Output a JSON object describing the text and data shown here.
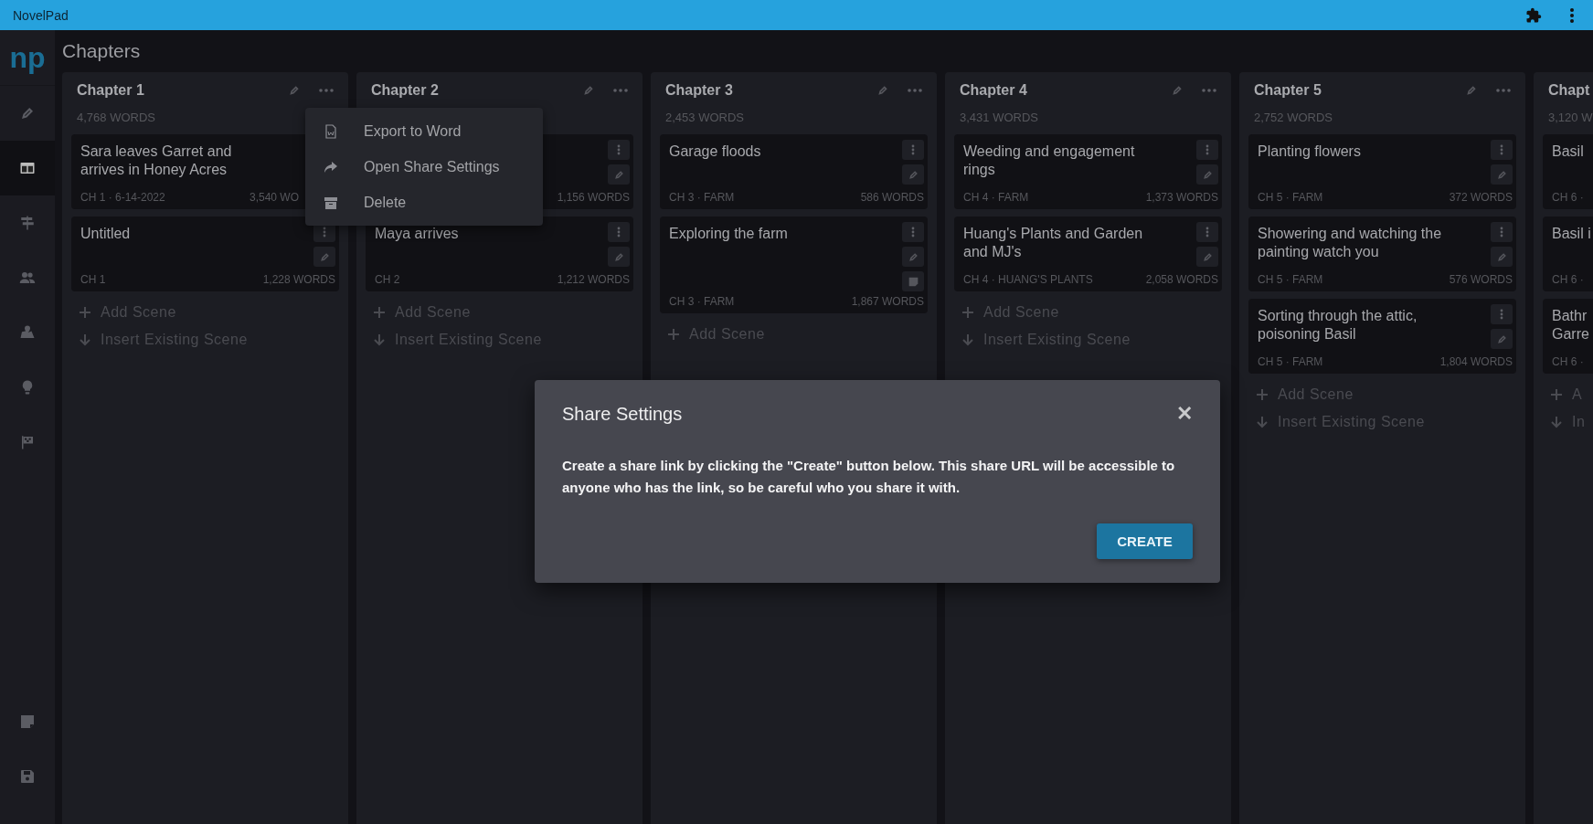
{
  "app_bar": {
    "title": "NovelPad"
  },
  "sidebar": {
    "logo": "np",
    "items": [
      {
        "selected": false
      },
      {
        "selected": true
      },
      {
        "selected": false
      },
      {
        "selected": false
      },
      {
        "selected": false
      },
      {
        "selected": false
      },
      {
        "selected": false
      }
    ]
  },
  "page_title": "Chapters",
  "chapters": [
    {
      "kind": "full",
      "title": "Chapter 1",
      "words": "4,768 WORDS",
      "scenes": [
        {
          "title": "Sara leaves Garret and arrives in Honey Acres",
          "meta": "CH 1 · 6-14-2022",
          "words": "3,540 WO"
        },
        {
          "title": "Untitled",
          "meta": "CH 1",
          "words": "1,228 WORDS",
          "has_note": false
        }
      ],
      "actions": [
        {
          "kind": "add",
          "label": "Add Scene"
        },
        {
          "kind": "insert",
          "label": "Insert Existing Scene"
        }
      ]
    },
    {
      "kind": "full",
      "title": "Chapter 2",
      "scenes": [
        {
          "words": "1,156 WORDS",
          "has_note": false
        },
        {
          "title": "Maya arrives",
          "meta": "CH 2",
          "words": "1,212 WORDS",
          "has_note": false
        }
      ],
      "actions": [
        {
          "kind": "add",
          "label": "Add Scene"
        },
        {
          "kind": "insert",
          "label": "Insert Existing Scene"
        }
      ]
    },
    {
      "kind": "full",
      "title": "Chapter 3",
      "words": "2,453 WORDS",
      "scenes": [
        {
          "title": "Garage floods",
          "meta": "CH 3 · FARM",
          "words": "586 WORDS",
          "has_note": false
        },
        {
          "title": "Exploring the farm",
          "meta": "CH 3 · FARM",
          "words": "1,867 WORDS",
          "has_note": true
        }
      ],
      "actions": [
        {
          "kind": "add",
          "label": "Add Scene"
        }
      ]
    },
    {
      "kind": "full",
      "title": "Chapter 4",
      "words": "3,431 WORDS",
      "scenes": [
        {
          "title": "Weeding and engagement rings",
          "meta": "CH 4 · FARM",
          "words": "1,373 WORDS",
          "has_note": false
        },
        {
          "title": "Huang's Plants and Garden and MJ's",
          "meta": "CH 4 · HUANG'S PLANTS",
          "words": "2,058 WORDS",
          "has_note": false
        }
      ],
      "actions": [
        {
          "kind": "add",
          "label": "Add Scene"
        },
        {
          "kind": "insert",
          "label": "Insert Existing Scene"
        }
      ]
    },
    {
      "kind": "full",
      "title": "Chapter 5",
      "words": "2,752 WORDS",
      "scenes": [
        {
          "title": "Planting flowers",
          "meta": "CH 5 · FARM",
          "words": "372 WORDS",
          "has_note": false
        },
        {
          "title": "Showering and watching the painting watch you",
          "meta": "CH 5 · FARM",
          "words": "576 WORDS",
          "has_note": false
        },
        {
          "title": "Sorting through the attic, poisoning Basil",
          "meta": "CH 5 · FARM",
          "words": "1,804 WORDS",
          "has_note": false
        }
      ],
      "actions": [
        {
          "kind": "add",
          "label": "Add Scene"
        },
        {
          "kind": "insert",
          "label": "Insert Existing Scene"
        }
      ]
    },
    {
      "kind": "clipped",
      "title": "Chapt",
      "words": "3,120 W",
      "scenes": [
        {
          "title": "Basil",
          "meta": "CH 6 ·"
        },
        {
          "title": "Basil i",
          "meta": "CH 6 ·"
        },
        {
          "title": "Bathr Garre",
          "meta": "CH 6 ·"
        }
      ],
      "actions": [
        {
          "kind": "add",
          "label": "A"
        },
        {
          "kind": "insert",
          "label": "In"
        }
      ]
    }
  ],
  "menu": {
    "items": [
      {
        "label": "Export to Word"
      },
      {
        "label": "Open Share Settings"
      },
      {
        "label": "Delete"
      }
    ]
  },
  "dialog": {
    "title": "Share Settings",
    "close": "✕",
    "body": "Create a share link by clicking the \"Create\" button below. This share URL will be accessible to anyone who has the link, so be careful who you share it with.",
    "button": "CREATE"
  }
}
